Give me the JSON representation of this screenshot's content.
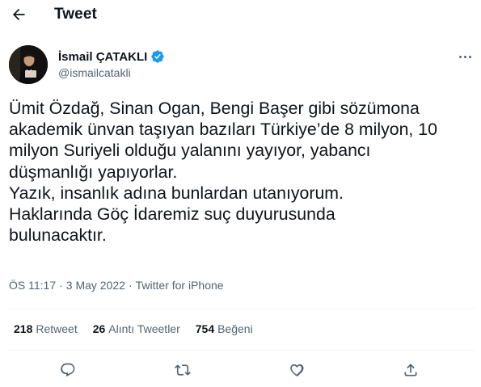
{
  "header": {
    "title": "Tweet"
  },
  "author": {
    "display_name": "İsmail ÇATAKLI",
    "handle": "@ismailcatakli",
    "verified": true,
    "verified_color": "#1d9bf0"
  },
  "tweet": {
    "lines": [
      "Ümit Özdağ, Sinan Ogan, Bengi Başer gibi sözümona",
      "akademik ünvan taşıyan bazıları Türkiye’de 8 milyon, 10",
      "milyon Suriyeli olduğu yalanını yayıyor, yabancı",
      "düşmanlığı yapıyorlar.",
      "Yazık, insanlık adına bunlardan utanıyorum.",
      "Haklarında Göç İdaremiz suç duyurusunda",
      "bulunacaktır."
    ],
    "time": "ÖS 11:17",
    "date": "3 May 2022",
    "separator": "·",
    "source": "Twitter for iPhone"
  },
  "stats": [
    {
      "count": "218",
      "label": "Retweet"
    },
    {
      "count": "26",
      "label": "Alıntı Tweetler"
    },
    {
      "count": "754",
      "label": "Beğeni"
    }
  ],
  "icons": {
    "back": "arrow-left-icon",
    "more": "more-options-icon",
    "reply": "reply-icon",
    "retweet": "retweet-icon",
    "like": "heart-icon",
    "share": "share-icon",
    "verified": "verified-badge-icon"
  },
  "colors": {
    "text": "#0f1419",
    "secondary": "#536471",
    "divider": "#eff3f4",
    "accent": "#1d9bf0"
  }
}
